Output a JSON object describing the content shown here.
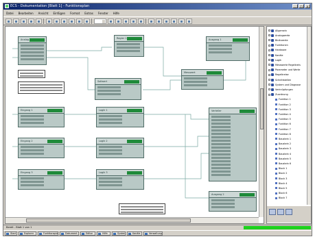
{
  "window": {
    "title": "ECS - Dokumentation [Blatt 1] - Funktionsplan"
  },
  "menu": [
    "Datei",
    "Bearbeiten",
    "Ansicht",
    "Einfügen",
    "Format",
    "Extras",
    "Fenster",
    "Hilfe"
  ],
  "toolbar": {
    "button_count": 26
  },
  "blocks": [
    {
      "label": "Analog In 1"
    },
    {
      "label": "Regler 1"
    },
    {
      "label": "Sollwert"
    },
    {
      "label": "Messwert"
    },
    {
      "label": "Ausgang 1"
    },
    {
      "label": "Eingang 1"
    },
    {
      "label": "Logik 1"
    },
    {
      "label": "Eingang 2"
    },
    {
      "label": "Logik 2"
    },
    {
      "label": "Eingang 3"
    },
    {
      "label": "Logik 3"
    },
    {
      "label": "Verteiler"
    },
    {
      "label": "Ausgang 2"
    }
  ],
  "tree": [
    {
      "label": "Allgemein",
      "level": 0
    },
    {
      "label": "Analogwerte",
      "level": 0
    },
    {
      "label": "Binärwerte",
      "level": 0
    },
    {
      "label": "Funktionen",
      "level": 0
    },
    {
      "label": "Hardware",
      "level": 0
    },
    {
      "label": "Kanäle",
      "level": 0
    },
    {
      "label": "Logik",
      "level": 0
    },
    {
      "label": "Messwerte Regelkreis",
      "level": 0
    },
    {
      "label": "Parameter und Werte",
      "level": 0
    },
    {
      "label": "Regelkreise",
      "level": 0
    },
    {
      "label": "Schnittstellen",
      "level": 0
    },
    {
      "label": "System und Diagnose",
      "level": 0
    },
    {
      "label": "Verknüpfungen",
      "level": 0
    },
    {
      "label": "Zuordnung",
      "level": 0
    },
    {
      "label": "Funktion 1",
      "level": 1
    },
    {
      "label": "Funktion 2",
      "level": 1
    },
    {
      "label": "Funktion 3",
      "level": 1
    },
    {
      "label": "Funktion 4",
      "level": 1
    },
    {
      "label": "Funktion 5",
      "level": 1
    },
    {
      "label": "Funktion 6",
      "level": 1
    },
    {
      "label": "Funktion 7",
      "level": 1
    },
    {
      "label": "Funktion 8",
      "level": 1
    },
    {
      "label": "Baustein 1",
      "level": 1
    },
    {
      "label": "Baustein 2",
      "level": 1
    },
    {
      "label": "Baustein 3",
      "level": 1
    },
    {
      "label": "Baustein 4",
      "level": 1
    },
    {
      "label": "Baustein 5",
      "level": 1
    },
    {
      "label": "Baustein 6",
      "level": 1
    },
    {
      "label": "Block 1",
      "level": 1
    },
    {
      "label": "Block 2",
      "level": 1
    },
    {
      "label": "Block 3",
      "level": 1
    },
    {
      "label": "Block 4",
      "level": 1
    },
    {
      "label": "Block 5",
      "level": 1
    },
    {
      "label": "Block 6",
      "level": 1
    },
    {
      "label": "Block 7",
      "level": 1
    }
  ],
  "status": {
    "text": "Bereit - Blatt 1 von 1",
    "ok_label": ""
  },
  "taskbar": [
    "Start",
    "Explorer",
    "Funktionsplan",
    "Dokument",
    "Editor",
    "Hilfe",
    "System",
    "Kanäle",
    "Verwaltung"
  ],
  "colors": {
    "block_fill": "#b9c9c6",
    "block_tag": "#1f8a3a",
    "status_ok": "#1dd11d",
    "title_bar": "#0a246a"
  }
}
